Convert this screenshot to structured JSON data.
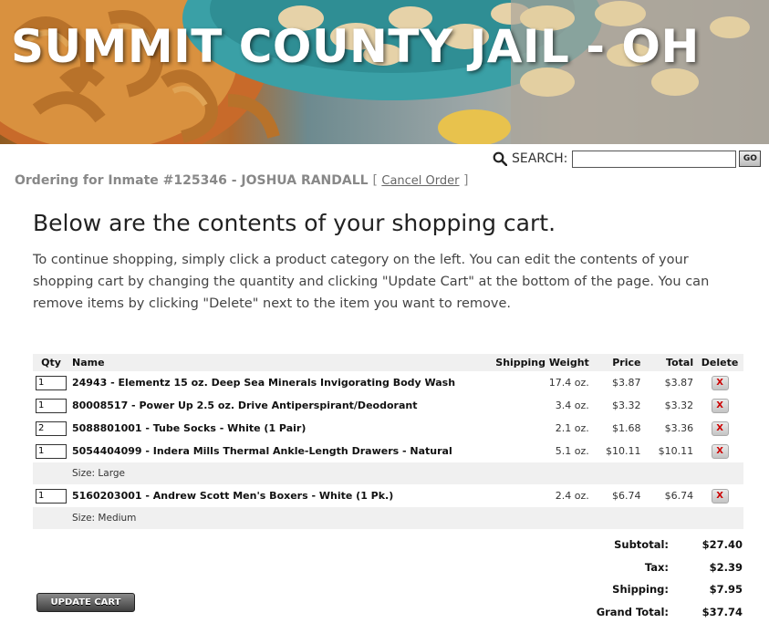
{
  "banner": {
    "title": "SUMMIT COUNTY JAIL - OH"
  },
  "search": {
    "label": "SEARCH:",
    "value": "",
    "go_label": "GO"
  },
  "ordering": {
    "text": "Ordering for Inmate #125346 - JOSHUA RANDALL",
    "bracket_open": "[",
    "cancel_label": "Cancel Order",
    "bracket_close": "]"
  },
  "main": {
    "heading": "Below are the contents of your shopping cart.",
    "intro": "To continue shopping, simply click a product category on the left. You can edit the contents of your shopping cart by changing the quantity and clicking \"Update Cart\" at the bottom of the page. You can remove items by clicking \"Delete\" next to the item you want to remove."
  },
  "cart": {
    "headers": {
      "qty": "Qty",
      "name": "Name",
      "weight": "Shipping Weight",
      "price": "Price",
      "total": "Total",
      "delete": "Delete"
    },
    "items": [
      {
        "qty": "1",
        "name": "24943 - Elementz 15 oz. Deep Sea Minerals Invigorating Body Wash",
        "weight": "17.4 oz.",
        "price": "$3.87",
        "total": "$3.87",
        "delete": "X"
      },
      {
        "qty": "1",
        "name": "80008517 - Power Up 2.5 oz. Drive Antiperspirant/Deodorant",
        "weight": "3.4 oz.",
        "price": "$3.32",
        "total": "$3.32",
        "delete": "X"
      },
      {
        "qty": "2",
        "name": "5088801001 - Tube Socks - White (1 Pair)",
        "weight": "2.1 oz.",
        "price": "$1.68",
        "total": "$3.36",
        "delete": "X"
      },
      {
        "qty": "1",
        "name": "5054404099 - Indera Mills Thermal Ankle-Length Drawers - Natural",
        "weight": "5.1 oz.",
        "price": "$10.11",
        "total": "$10.11",
        "delete": "X",
        "option": "Size: Large"
      },
      {
        "qty": "1",
        "name": "5160203001 - Andrew Scott Men's Boxers - White (1 Pk.)",
        "weight": "2.4 oz.",
        "price": "$6.74",
        "total": "$6.74",
        "delete": "X",
        "option": "Size: Medium"
      }
    ]
  },
  "totals": {
    "subtotal_label": "Subtotal:",
    "subtotal": "$27.40",
    "tax_label": "Tax:",
    "tax": "$2.39",
    "shipping_label": "Shipping:",
    "shipping": "$7.95",
    "grand_label": "Grand Total:",
    "grand": "$37.74"
  },
  "update_label": "UPDATE CART",
  "colors": {
    "table_header_bg": "#f0f0f0",
    "delete_x": "#cc0000",
    "muted_text": "#888888"
  },
  "icons": {
    "search": "magnifier-icon",
    "delete": "x-icon"
  }
}
